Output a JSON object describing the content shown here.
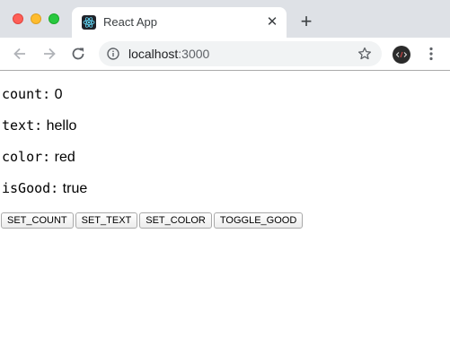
{
  "browser": {
    "tab": {
      "title": "React App",
      "close_glyph": "✕",
      "favicon": "react-icon"
    },
    "new_tab_glyph": "+",
    "address": {
      "host": "localhost",
      "port": ":3000"
    },
    "icons": [
      "back-arrow-icon",
      "forward-arrow-icon",
      "reload-icon",
      "info-icon",
      "star-icon",
      "extension-icon",
      "kebab-menu-icon"
    ]
  },
  "app": {
    "state": [
      {
        "key": "count:",
        "value": "0"
      },
      {
        "key": "text:",
        "value": "hello"
      },
      {
        "key": "color:",
        "value": "red"
      },
      {
        "key": "isGood:",
        "value": "true"
      }
    ],
    "buttons": [
      "SET_COUNT",
      "SET_TEXT",
      "SET_COLOR",
      "TOGGLE_GOOD"
    ]
  }
}
